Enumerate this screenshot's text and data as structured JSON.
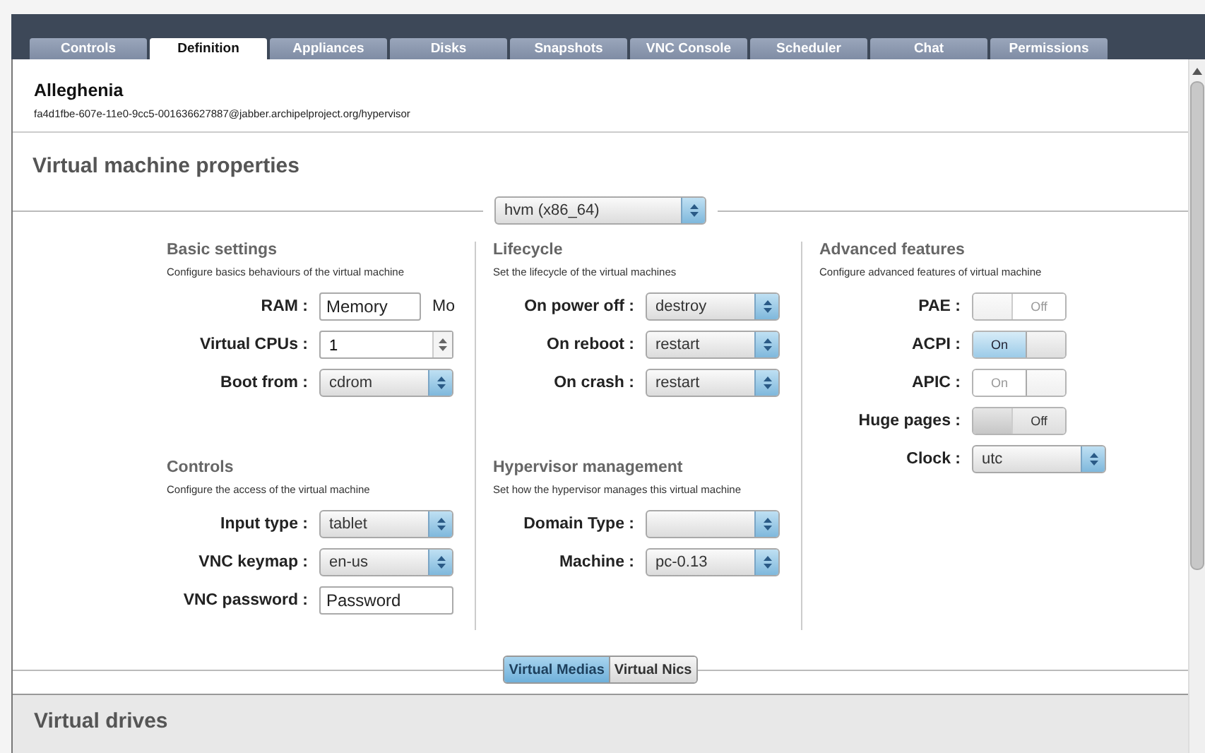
{
  "tabs": [
    {
      "label": "Controls",
      "selected": false
    },
    {
      "label": "Definition",
      "selected": true
    },
    {
      "label": "Appliances",
      "selected": false
    },
    {
      "label": "Disks",
      "selected": false
    },
    {
      "label": "Snapshots",
      "selected": false
    },
    {
      "label": "VNC Console",
      "selected": false
    },
    {
      "label": "Scheduler",
      "selected": false
    },
    {
      "label": "Chat",
      "selected": false
    },
    {
      "label": "Permissions",
      "selected": false
    }
  ],
  "header": {
    "title": "Alleghenia",
    "jid": "fa4d1fbe-607e-11e0-9cc5-001636627887@jabber.archipelproject.org/hypervisor"
  },
  "section_title": "Virtual machine properties",
  "architecture_select": {
    "value": "hvm (x86_64)"
  },
  "columns": [
    {
      "groups": [
        {
          "title": "Basic settings",
          "description": "Configure basics behaviours of the virtual machine",
          "fields": [
            {
              "kind": "text",
              "label": "RAM :",
              "placeholder": "Memory",
              "unit": "Mo"
            },
            {
              "kind": "spinner",
              "label": "Virtual CPUs :",
              "value": "1"
            },
            {
              "kind": "select",
              "label": "Boot from :",
              "value": "cdrom"
            }
          ]
        },
        {
          "title": "Controls",
          "description": "Configure the access of the virtual machine",
          "fields": [
            {
              "kind": "select",
              "label": "Input type :",
              "value": "tablet"
            },
            {
              "kind": "select",
              "label": "VNC keymap :",
              "value": "en-us"
            },
            {
              "kind": "text",
              "label": "VNC password :",
              "placeholder": "Password"
            }
          ]
        }
      ]
    },
    {
      "groups": [
        {
          "title": "Lifecycle",
          "description": "Set the lifecycle of the virtual machines",
          "fields": [
            {
              "kind": "select",
              "label": "On power off :",
              "value": "destroy"
            },
            {
              "kind": "select",
              "label": "On reboot :",
              "value": "restart"
            },
            {
              "kind": "select",
              "label": "On crash :",
              "value": "restart"
            }
          ]
        },
        {
          "title": "Hypervisor management",
          "description": "Set how the hypervisor manages this virtual machine",
          "fields": [
            {
              "kind": "select",
              "label": "Domain Type :"
            },
            {
              "kind": "select",
              "label": "Machine :",
              "value": "pc-0.13"
            }
          ]
        }
      ]
    },
    {
      "groups": [
        {
          "title": "Advanced features",
          "description": "Configure advanced features of virtual machine",
          "fields": [
            {
              "kind": "toggle",
              "label": "PAE :",
              "on": false,
              "disabled": true,
              "text": "Off"
            },
            {
              "kind": "toggle",
              "label": "ACPI :",
              "on": true,
              "disabled": false,
              "text": "On"
            },
            {
              "kind": "toggle",
              "label": "APIC :",
              "on": true,
              "disabled": true,
              "text": "On"
            },
            {
              "kind": "toggle",
              "label": "Huge pages :",
              "on": false,
              "disabled": false,
              "text": "Off"
            },
            {
              "kind": "select",
              "label": "Clock :",
              "value": "utc"
            }
          ]
        }
      ]
    }
  ],
  "subtabs": [
    {
      "label": "Virtual Medias",
      "selected": true
    },
    {
      "label": "Virtual Nics",
      "selected": false
    }
  ],
  "drives_title": "Virtual drives"
}
